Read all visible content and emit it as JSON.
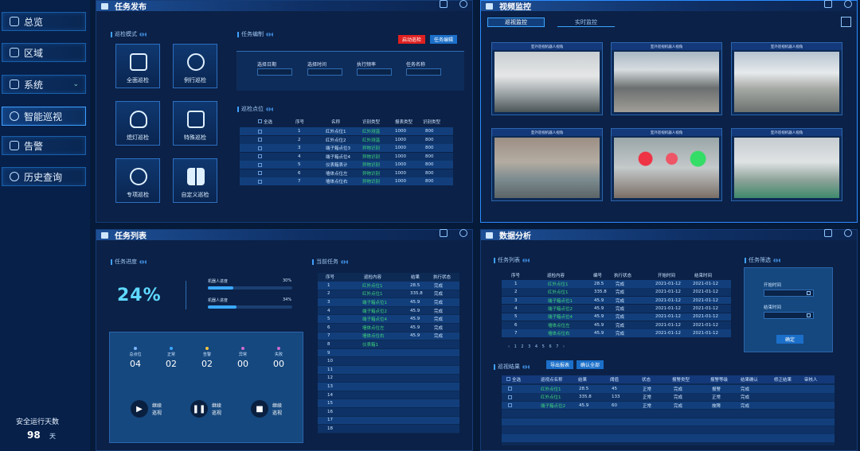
{
  "sidebar": {
    "items": [
      {
        "label": "总览",
        "icon": "layers-icon"
      },
      {
        "label": "区域",
        "icon": "map-pin-icon"
      },
      {
        "label": "系统",
        "icon": "gear-icon",
        "chevron": "⌄"
      },
      {
        "label": "智能巡视",
        "icon": "location-icon"
      },
      {
        "label": "告警",
        "icon": "warning-icon"
      },
      {
        "label": "历史查询",
        "icon": "search-icon"
      }
    ],
    "safety_label": "安全运行天数",
    "safety_days": "98",
    "safety_unit": "天"
  },
  "task_publish": {
    "title": "任务发布",
    "mode_title": "巡检模式",
    "modes": [
      "全面巡检",
      "例行巡检",
      "熄灯巡检",
      "特殊巡检",
      "专项巡检",
      "自定义巡检"
    ],
    "edit_title": "任务编制",
    "btn_start": "启动巡检",
    "btn_edit": "任务编辑",
    "fields": [
      "选择日期",
      "选择时间",
      "执行频率",
      "任务名称"
    ],
    "points_title": "巡检点位",
    "points_header": [
      "全选",
      "序号",
      "名称",
      "识别类型",
      "报表类型",
      "识别类型"
    ],
    "points_rows": [
      [
        "1",
        "红外点位1",
        "红外测温",
        "1000",
        "800"
      ],
      [
        "2",
        "红外点位2",
        "红外测温",
        "1000",
        "800"
      ],
      [
        "3",
        "端子箱点位3",
        "异物识别",
        "1000",
        "800"
      ],
      [
        "4",
        "端子箱点位4",
        "异物识别",
        "1000",
        "800"
      ],
      [
        "5",
        "仪表箱表计",
        "异物识别",
        "1000",
        "800"
      ],
      [
        "6",
        "墙体点位左",
        "异物识别",
        "1000",
        "800"
      ],
      [
        "7",
        "墙体点位右",
        "异物识别",
        "1000",
        "800"
      ]
    ]
  },
  "video": {
    "title": "视频监控",
    "tabs": [
      "巡视监控",
      "实时监控"
    ],
    "feed_label": "室外巡视机器人视角"
  },
  "task_list": {
    "title": "任务列表",
    "progress_title": "任务进度",
    "percent": "24%",
    "robot_label_1": "机器人进度",
    "robot_pct_1": "30%",
    "robot_val_1": 0.3,
    "robot_label_2": "机器人进度",
    "robot_pct_2": "34%",
    "robot_val_2": 0.34,
    "stats": [
      {
        "label": "总点位",
        "value": "04"
      },
      {
        "label": "正常",
        "value": "02"
      },
      {
        "label": "告警",
        "value": "02"
      },
      {
        "label": "异常",
        "value": "00"
      },
      {
        "label": "失败",
        "value": "00"
      }
    ],
    "controls": [
      "继续\n巡视",
      "继续\n巡视",
      "继续\n巡视"
    ],
    "current_title": "当前任务",
    "current_header": [
      "序号",
      "巡检内容",
      "结果",
      "执行状态"
    ],
    "current_rows": [
      [
        "1",
        "红外点位1",
        "28.5",
        "完成"
      ],
      [
        "2",
        "红外点位1",
        "335.8",
        "完成"
      ],
      [
        "3",
        "端子箱点位1",
        "45.9",
        "完成"
      ],
      [
        "4",
        "端子箱点位2",
        "45.9",
        "完成"
      ],
      [
        "5",
        "端子箱点位4",
        "45.9",
        "完成"
      ],
      [
        "6",
        "墙体点位左",
        "45.9",
        "完成"
      ],
      [
        "7",
        "墙体点位右",
        "45.9",
        "完成"
      ],
      [
        "8",
        "仪表箱1",
        "",
        ""
      ],
      [
        "9",
        "",
        "",
        ""
      ],
      [
        "10",
        "",
        "",
        ""
      ],
      [
        "11",
        "",
        "",
        ""
      ],
      [
        "12",
        "",
        "",
        ""
      ],
      [
        "13",
        "",
        "",
        ""
      ],
      [
        "14",
        "",
        "",
        ""
      ],
      [
        "15",
        "",
        "",
        ""
      ],
      [
        "16",
        "",
        "",
        ""
      ],
      [
        "17",
        "",
        "",
        ""
      ],
      [
        "18",
        "",
        "",
        ""
      ]
    ]
  },
  "analysis": {
    "title": "数据分析",
    "list_title": "任务列表",
    "list_header": [
      "序号",
      "巡检内容",
      "编号",
      "执行状态",
      "开始时间",
      "结束时间"
    ],
    "list_rows": [
      [
        "1",
        "红外点位1",
        "28.5",
        "完成",
        "2021-01-12",
        "2021-01-12"
      ],
      [
        "2",
        "红外点位1",
        "335.8",
        "完成",
        "2021-01-12",
        "2021-01-12"
      ],
      [
        "3",
        "端子箱点位1",
        "45.9",
        "完成",
        "2021-01-12",
        "2021-01-12"
      ],
      [
        "4",
        "端子箱点位2",
        "45.9",
        "完成",
        "2021-01-12",
        "2021-01-12"
      ],
      [
        "5",
        "端子箱点位4",
        "45.9",
        "完成",
        "2021-01-12",
        "2021-01-12"
      ],
      [
        "6",
        "墙体点位左",
        "45.9",
        "完成",
        "2021-01-12",
        "2021-01-12"
      ],
      [
        "7",
        "墙体点位右",
        "45.9",
        "完成",
        "2021-01-12",
        "2021-01-12"
      ]
    ],
    "pager": "‹ 1 2 3 4 5 6 7 ›",
    "filter_title": "任务筛选",
    "start_label": "开始时间",
    "end_label": "结束时间",
    "confirm": "确定",
    "result_title": "巡视结果",
    "btn_export": "导出报表",
    "btn_confirm_all": "确认全部",
    "result_header": [
      "全选",
      "巡视点名称",
      "结果",
      "阈值",
      "状态",
      "报警类型",
      "报警等级",
      "结果确认",
      "修正结果",
      "审核人"
    ],
    "result_rows": [
      [
        "红外点位1",
        "28.5",
        "45",
        "正常",
        "完成",
        "报警",
        "完成"
      ],
      [
        "红外点位1",
        "335.8",
        "133",
        "正常",
        "完成",
        "正常",
        "完成"
      ],
      [
        "端子箱点位2",
        "45.9",
        "60",
        "正常",
        "完成",
        "故障",
        "完成"
      ]
    ]
  }
}
